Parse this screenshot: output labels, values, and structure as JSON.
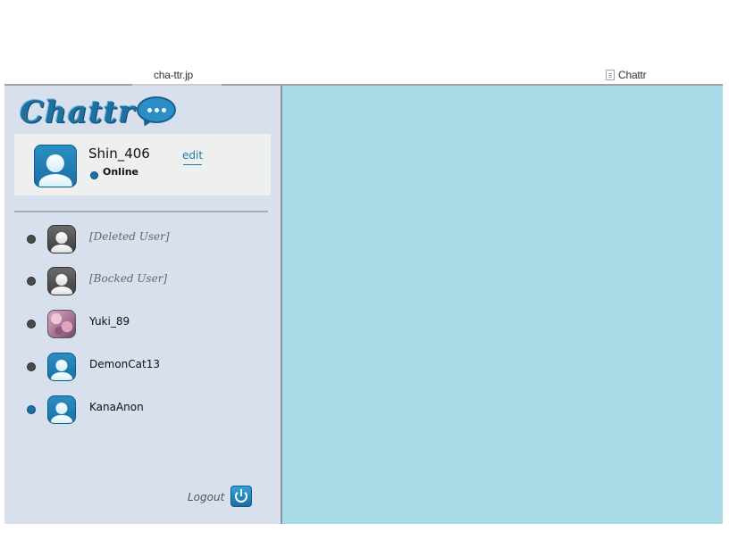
{
  "browser": {
    "url": "cha-ttr.jp",
    "tab_title": "Chattr"
  },
  "app": {
    "logo_text": "Chattr",
    "colors": {
      "sidebar": "#d7e0ec",
      "chat_area": "#a7dbe8",
      "accent": "#1e7ab0"
    }
  },
  "profile": {
    "username": "Shin_406",
    "status": "Online",
    "edit_label": "edit"
  },
  "contacts": [
    {
      "name": "[Deleted User]",
      "status": "offline",
      "avatar": "gray-person"
    },
    {
      "name": "[Bocked User]",
      "status": "offline",
      "avatar": "gray-person"
    },
    {
      "name": "Yuki_89",
      "status": "offline",
      "avatar": "photo"
    },
    {
      "name": "DemonCat13",
      "status": "offline",
      "avatar": "blue-person"
    },
    {
      "name": "KanaAnon",
      "status": "online",
      "avatar": "blue-person"
    }
  ],
  "logout": {
    "label": "Logout",
    "icon": "power-icon"
  }
}
